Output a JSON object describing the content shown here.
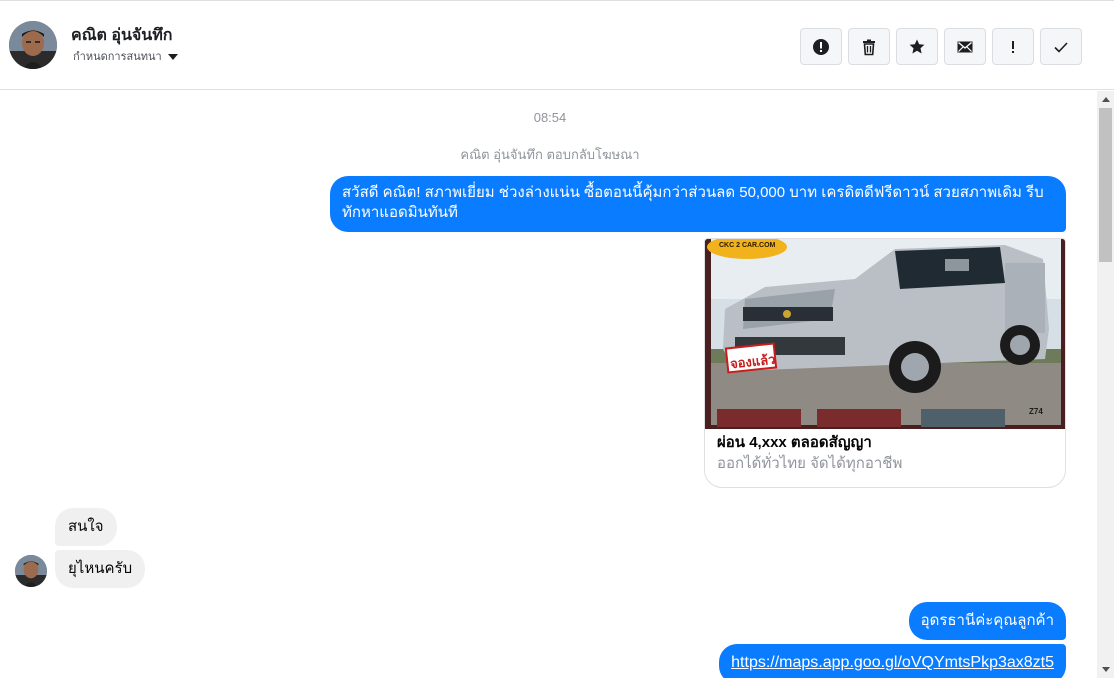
{
  "header": {
    "contact_name": "คณิต อุ่นจันทึก",
    "assign_label": "กำหนดการสนทนา",
    "actions": [
      {
        "name": "report-spam-button",
        "icon": "alert-circle-icon"
      },
      {
        "name": "delete-button",
        "icon": "trash-icon"
      },
      {
        "name": "star-button",
        "icon": "star-icon"
      },
      {
        "name": "mark-unread-button",
        "icon": "envelope-icon"
      },
      {
        "name": "follow-up-button",
        "icon": "exclamation-icon",
        "glyph": "!"
      },
      {
        "name": "mark-done-button",
        "icon": "check-icon"
      }
    ]
  },
  "chat": {
    "timestamp": "08:54",
    "system_note": "คณิต อุ่นจันทึก ตอบกลับโฆษณา",
    "ad_message": "สวัสดี คณิต!  สภาพเยี่ยม ช่วงล่างแน่น  ซื้อตอนนี้คุ้มกว่าส่วนลด 50,000 บาท เครดิตดีฟรีดาวน์  สวยสภาพเดิม รีบทักหาแอดมินทันที",
    "ad_card": {
      "title": "ผ่อน 4,xxx ตลอดสัญญา",
      "subtitle": "ออกได้ทั่วไทย จัดได้ทุกอาชีพ",
      "image_brand": "CKC 2 CAR.COM",
      "image_stamp": "จองแล้ว",
      "image_code": "Z74"
    },
    "incoming": [
      {
        "text": "สนใจ"
      },
      {
        "text": "ยุไหนครับ"
      }
    ],
    "outgoing_reply": "อุดรธานีค่ะคุณลูกค้า",
    "outgoing_link": "https://maps.app.goo.gl/oVQYmtsPkp3ax8zt5"
  },
  "colors": {
    "accent": "#0a7cff",
    "incoming_bubble": "#f0f0f0",
    "muted_text": "#90949c"
  }
}
